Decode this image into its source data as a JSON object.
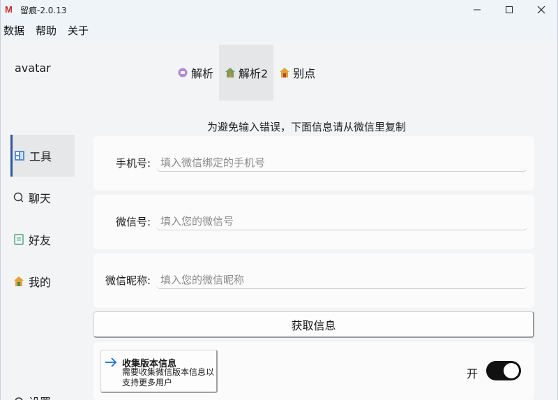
{
  "window": {
    "title": "留痕-2.0.13",
    "logo": "M"
  },
  "menu": [
    "数据",
    "帮助",
    "关于"
  ],
  "avatar_label": "avatar",
  "tabs": [
    {
      "label": "解析",
      "icon": "circle-icon",
      "active": false
    },
    {
      "label": "解析2",
      "icon": "house-icon",
      "active": true
    },
    {
      "label": "别点",
      "icon": "house-icon",
      "active": false
    }
  ],
  "sidebar": {
    "items": [
      {
        "label": "工具",
        "icon": "tools-icon",
        "active": true
      },
      {
        "label": "聊天",
        "icon": "chat-icon",
        "active": false
      },
      {
        "label": "好友",
        "icon": "contacts-icon",
        "active": false
      },
      {
        "label": "我的",
        "icon": "house-icon",
        "active": false
      }
    ],
    "settings_label": "设置"
  },
  "main": {
    "hint": "为避免输入错误，下面信息请从微信里复制",
    "fields": [
      {
        "label": "手机号:",
        "placeholder": "填入微信绑定的手机号",
        "value": ""
      },
      {
        "label": "微信号:",
        "placeholder": "填入您的微信号",
        "value": ""
      },
      {
        "label": "微信昵称:",
        "placeholder": "填入您的微信昵称",
        "value": ""
      }
    ],
    "get_button": "获取信息",
    "collect": {
      "title": "收集版本信息",
      "desc": "需要收集微信版本信息以支持更多用户",
      "toggle_label": "开",
      "toggle_on": true
    }
  },
  "colors": {
    "accent": "#2f5597",
    "toggle": "#111111",
    "logo": "#c62828"
  }
}
